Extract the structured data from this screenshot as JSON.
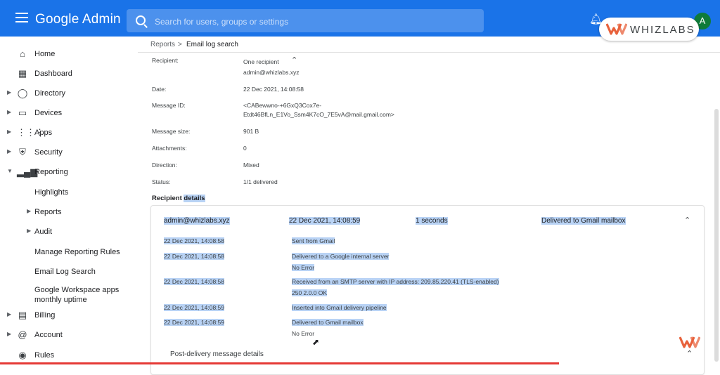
{
  "header": {
    "app_title": "Google Admin",
    "search_placeholder": "Search for users, groups or settings",
    "avatar_initial": "A",
    "watermark": "WHIZLABS"
  },
  "sidebar": {
    "items": [
      {
        "label": "Home",
        "icon": "home-icon"
      },
      {
        "label": "Dashboard",
        "icon": "dashboard-icon"
      },
      {
        "label": "Directory",
        "icon": "person-icon"
      },
      {
        "label": "Devices",
        "icon": "devices-icon"
      },
      {
        "label": "Apps",
        "icon": "apps-grid-icon"
      },
      {
        "label": "Security",
        "icon": "shield-icon"
      },
      {
        "label": "Reporting",
        "icon": "bar-chart-icon"
      },
      {
        "label": "Highlights"
      },
      {
        "label": "Reports"
      },
      {
        "label": "Audit"
      },
      {
        "label": "Manage Reporting Rules"
      },
      {
        "label": "Email Log Search"
      },
      {
        "label": "Google Workspace apps monthly uptime",
        "line1": "Google Workspace apps",
        "line2": "monthly uptime"
      },
      {
        "label": "Billing",
        "icon": "billing-icon"
      },
      {
        "label": "Account",
        "icon": "at-icon"
      },
      {
        "label": "Rules",
        "icon": "rules-icon"
      }
    ]
  },
  "breadcrumb": {
    "parent": "Reports",
    "separator": ">",
    "current": "Email log search"
  },
  "message": {
    "recipient_label": "Recipient:",
    "recipient_value": "One recipient",
    "recipient_address": "admin@whizlabs.xyz",
    "date_label": "Date:",
    "date_value": "22 Dec 2021, 14:08:58",
    "message_id_label": "Message ID:",
    "message_id_line1": "<CABewwno-+6GxQ3Cox7e-",
    "message_id_line2": "Etdt46BfLn_E1Vo_Ssm4K7cO_7E5vA@mail.gmail.com>",
    "size_label": "Message size:",
    "size_value": "901 B",
    "attachments_label": "Attachments:",
    "attachments_value": "0",
    "direction_label": "Direction:",
    "direction_value": "Mixed",
    "status_label": "Status:",
    "status_value": "1/1 delivered"
  },
  "recipient_details": {
    "title_part1": "Recipient ",
    "title_part2": "details",
    "address": "admin@whizlabs.xyz",
    "time": "22 Dec 2021, 14:08:59",
    "duration": "1 seconds",
    "status": "Delivered to Gmail mailbox",
    "events": [
      {
        "time": "22 Dec 2021, 14:08:58",
        "text": "Sent from Gmail",
        "detail": ""
      },
      {
        "time": "22 Dec 2021, 14:08:58",
        "text": "Delivered to a Google internal server",
        "detail": "No Error"
      },
      {
        "time": "22 Dec 2021, 14:08:58",
        "text": "Received from an SMTP server with IP address: 209.85.220.41 (TLS-enabled)",
        "detail": "250 2.0.0 OK"
      },
      {
        "time": "22 Dec 2021, 14:08:59",
        "text": "Inserted into Gmail delivery pipeline",
        "detail": ""
      },
      {
        "time": "22 Dec 2021, 14:08:59",
        "text": "Delivered to Gmail mailbox",
        "detail": "No Error"
      }
    ]
  },
  "post_delivery": {
    "label": "Post-delivery message details"
  },
  "colors": {
    "topbar": "#1a73e8",
    "selection": "#b9d3f5",
    "logo": "#e8623c"
  }
}
